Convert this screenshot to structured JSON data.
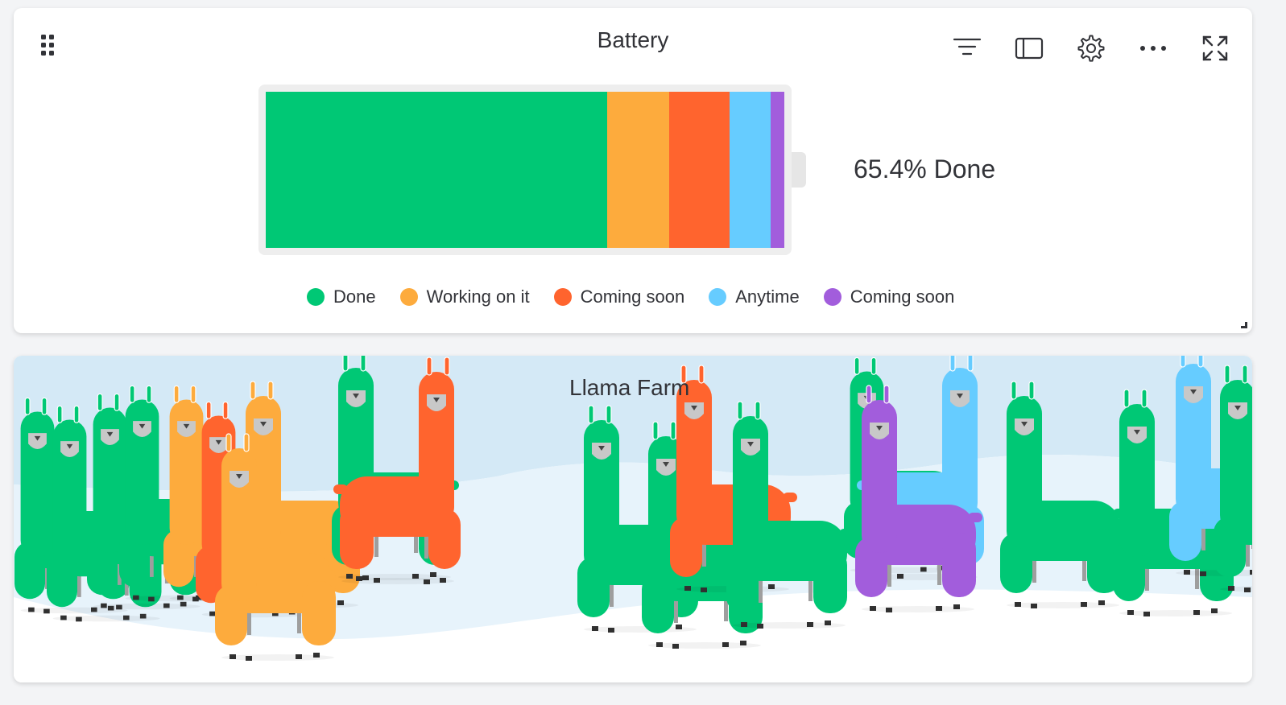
{
  "battery_widget": {
    "title": "Battery",
    "percent_text": "65.4% Done",
    "segments": [
      {
        "label": "Done",
        "share": 0.658,
        "color": "#00c875"
      },
      {
        "label": "Working on it",
        "share": 0.12,
        "color": "#fdab3d"
      },
      {
        "label": "Coming soon",
        "share": 0.117,
        "color": "#ff642e"
      },
      {
        "label": "Anytime",
        "share": 0.079,
        "color": "#66ccff"
      },
      {
        "label": "Coming soon",
        "share": 0.026,
        "color": "#a25ddc"
      }
    ],
    "toolbar": [
      {
        "icon": "filter-icon"
      },
      {
        "icon": "sidebar-panel-icon"
      },
      {
        "icon": "gear-icon"
      },
      {
        "icon": "more-horizontal-icon"
      },
      {
        "icon": "fullscreen-expand-icon"
      }
    ]
  },
  "llama_widget": {
    "title": "Llama Farm",
    "llama_colors": {
      "done": "#00c875",
      "working": "#fdab3d",
      "coming_soon": "#ff642e",
      "anytime": "#66ccff",
      "coming_soon_purple": "#a25ddc"
    }
  }
}
